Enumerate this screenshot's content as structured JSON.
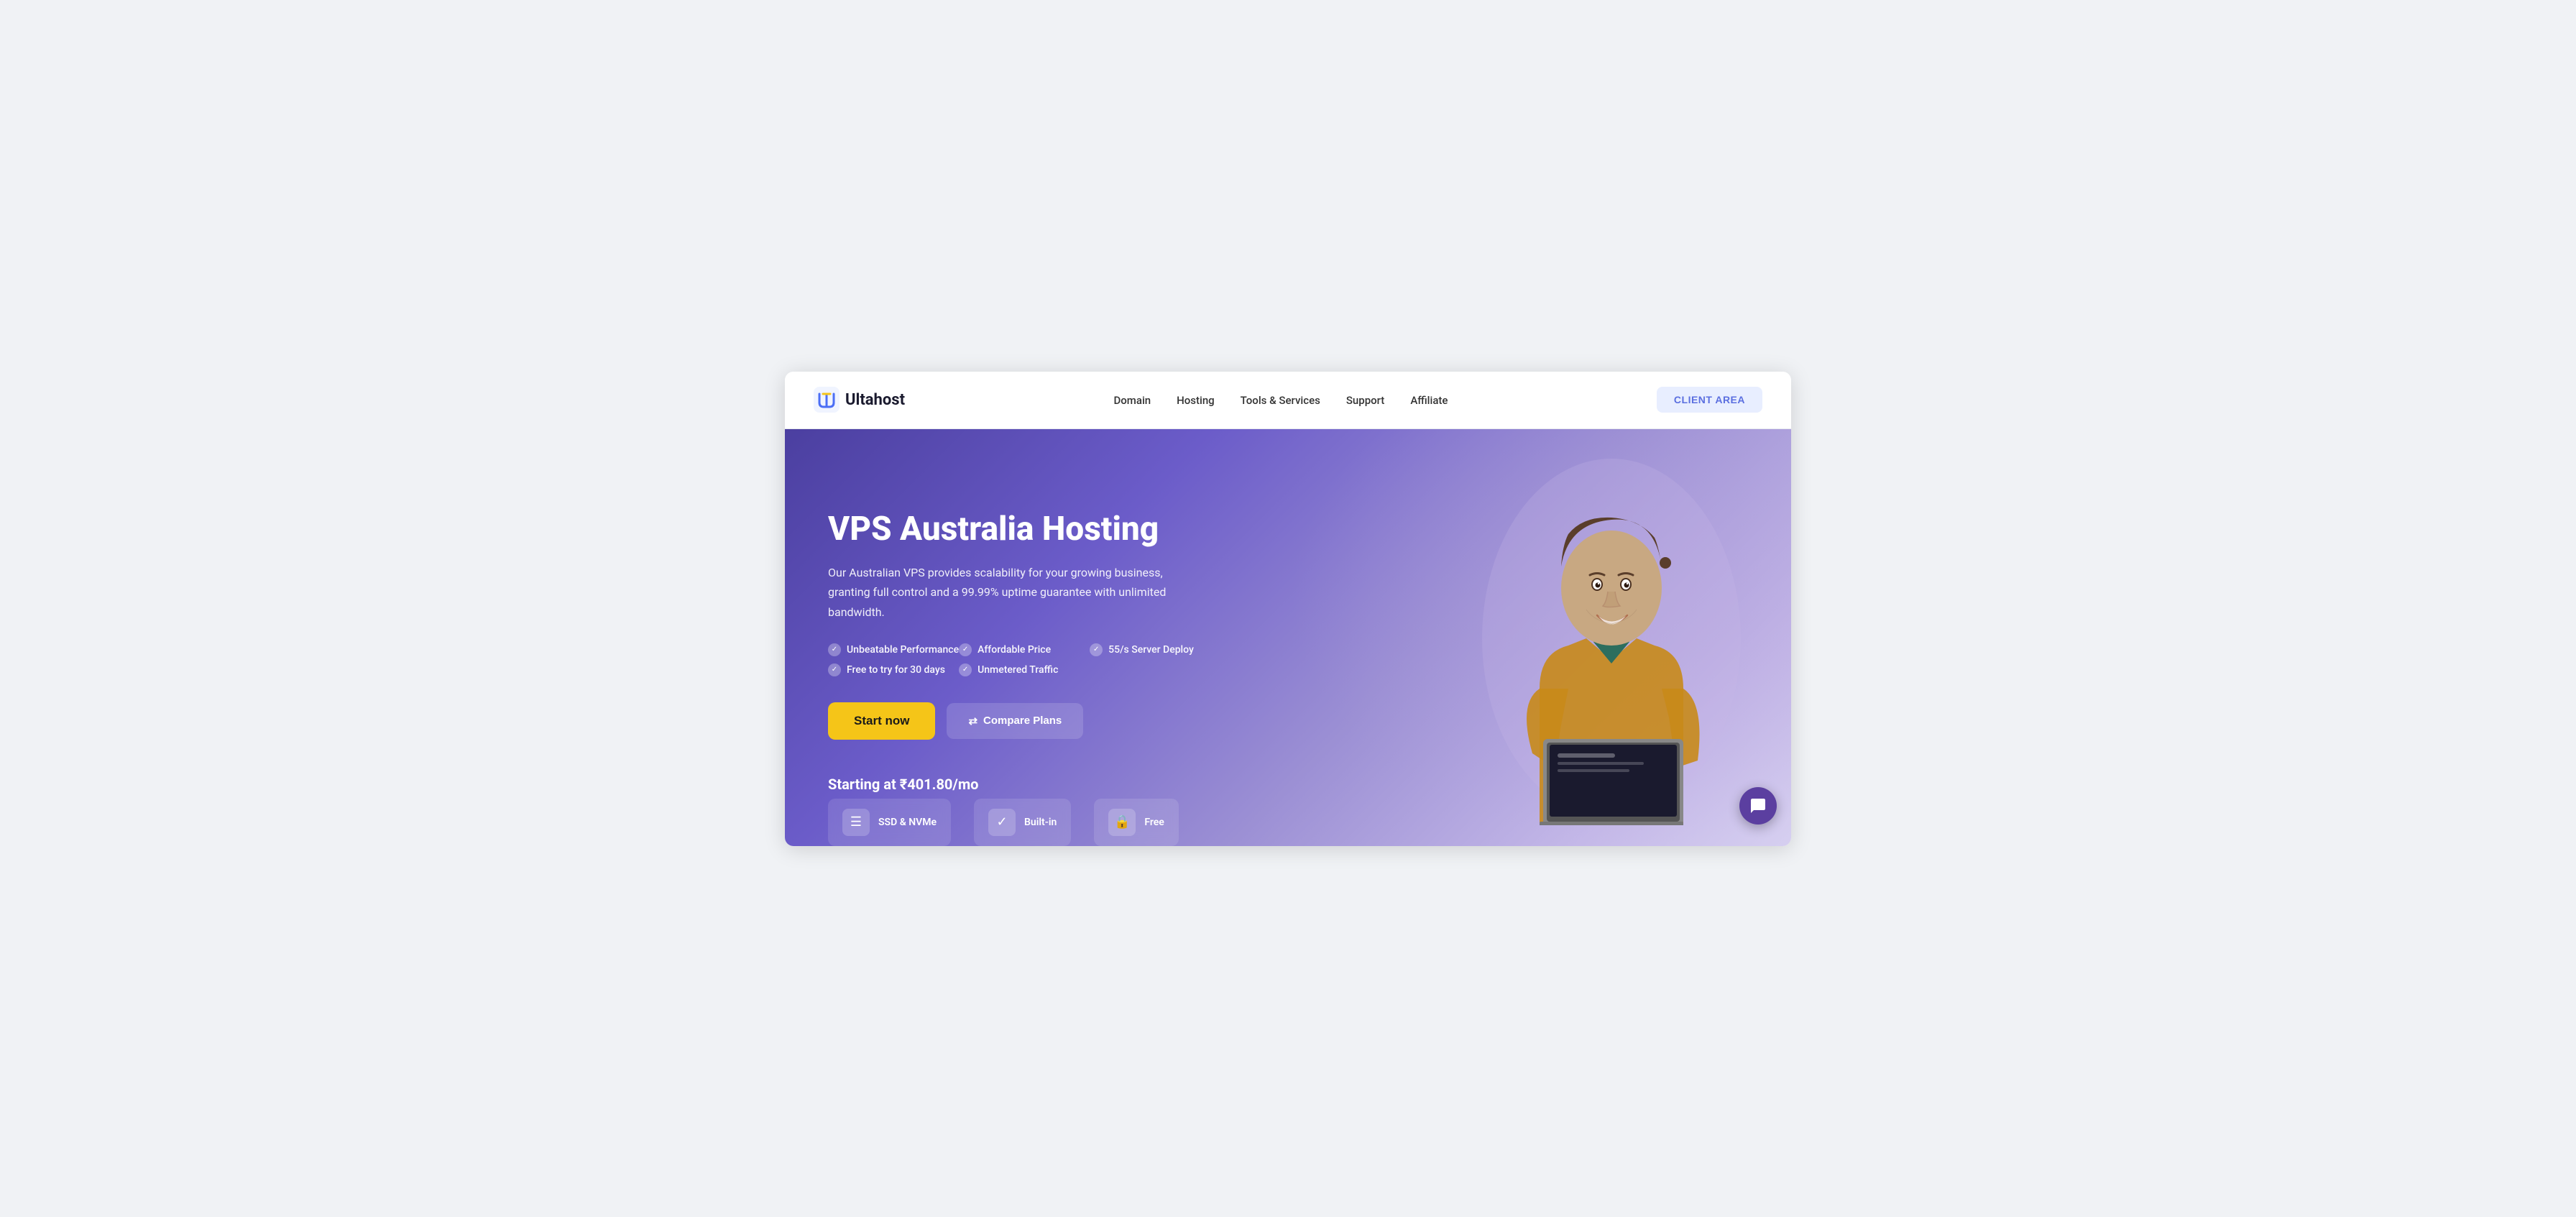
{
  "brand": {
    "name": "Ultahost",
    "logo_alt": "UH logo"
  },
  "navbar": {
    "links": [
      {
        "id": "domain",
        "label": "Domain"
      },
      {
        "id": "hosting",
        "label": "Hosting"
      },
      {
        "id": "tools",
        "label": "Tools & Services"
      },
      {
        "id": "support",
        "label": "Support"
      },
      {
        "id": "affiliate",
        "label": "Affiliate"
      }
    ],
    "cta": "CLIENT AREA"
  },
  "hero": {
    "title": "VPS Australia Hosting",
    "subtitle": "Our Australian VPS provides scalability for your growing business, granting full control and a 99.99% uptime guarantee with unlimited bandwidth.",
    "features": [
      {
        "id": "perf",
        "label": "Unbeatable Performance"
      },
      {
        "id": "price",
        "label": "Affordable Price"
      },
      {
        "id": "deploy",
        "label": "55/s Server Deploy"
      },
      {
        "id": "trial",
        "label": "Free to try for 30 days"
      },
      {
        "id": "traffic",
        "label": "Unmetered Traffic"
      }
    ],
    "btn_start": "Start now",
    "btn_compare_icon": "⇄",
    "btn_compare": "Compare Plans",
    "pricing": "Starting at ₹401.80/mo",
    "bottom_features": [
      {
        "id": "ssd",
        "icon": "☰",
        "label": "SSD & NVMe"
      },
      {
        "id": "builtin",
        "icon": "✓",
        "label": "Built-in"
      },
      {
        "id": "free",
        "icon": "🔒",
        "label": "Free"
      }
    ]
  }
}
